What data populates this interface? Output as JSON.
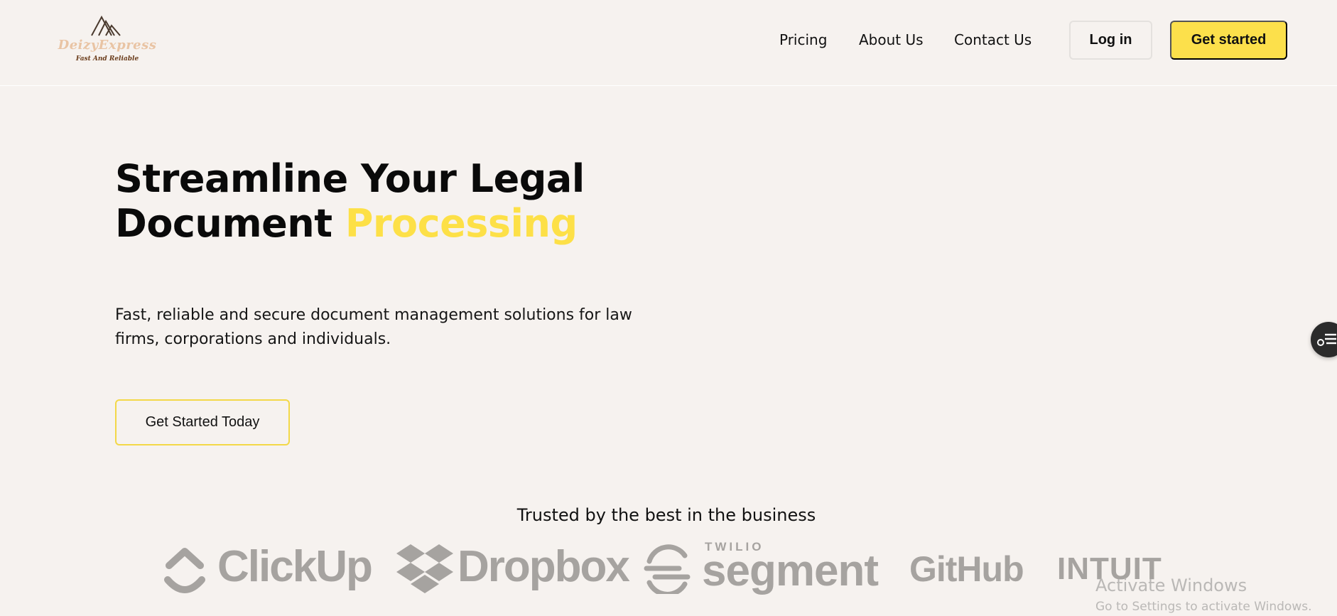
{
  "brand": {
    "name": "DeizyExpress",
    "tagline": "Fast And Reliable"
  },
  "nav": {
    "links": [
      {
        "label": "Pricing"
      },
      {
        "label": "About Us"
      },
      {
        "label": "Contact Us"
      }
    ],
    "login_label": "Log in",
    "get_started_label": "Get started"
  },
  "hero": {
    "title_line1": "Streamline Your Legal",
    "title_line2_plain": "Document ",
    "title_line2_highlight": "Processing",
    "subtitle": "Fast, reliable and secure document management solutions for law firms, corporations and individuals.",
    "cta_label": "Get Started Today"
  },
  "trusted": {
    "heading": "Trusted by the best in the business",
    "logos": [
      {
        "name": "ClickUp",
        "icon": "clickup-icon"
      },
      {
        "name": "Dropbox",
        "icon": "dropbox-icon"
      },
      {
        "name": "segment",
        "prefix": "TWILIO",
        "icon": "segment-icon"
      },
      {
        "name": "GitHub"
      },
      {
        "name": "INTUIT"
      }
    ]
  },
  "floating_widget": {
    "icon": "accessibility-menu-icon"
  },
  "os_watermark": {
    "line1": "Activate Windows",
    "line2": "Go to Settings to activate Windows."
  },
  "colors": {
    "background": "#f6f2ef",
    "accent": "#fde047",
    "button_yellow": "#fce04b",
    "logo_gray": "#a6a3a0"
  }
}
